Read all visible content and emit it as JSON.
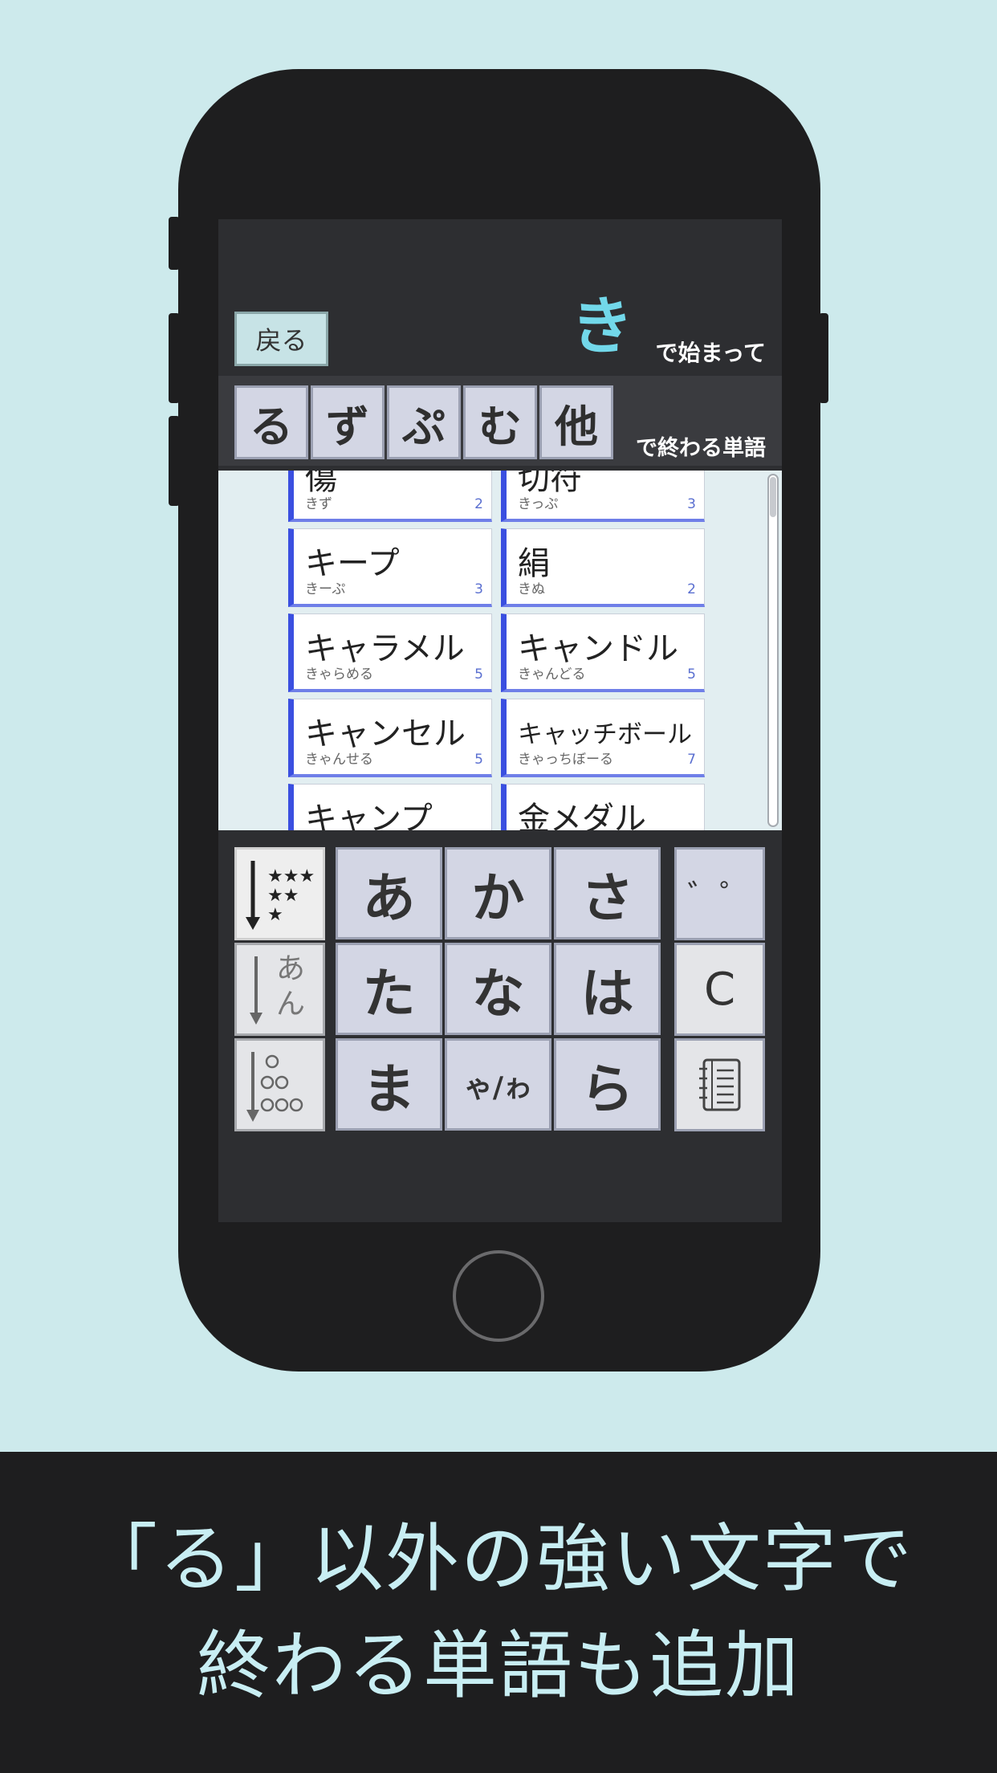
{
  "screen": {
    "back_label": "戻る",
    "start_char": "き",
    "start_suffix": "で始まって",
    "end_tabs": [
      "る",
      "ず",
      "ぷ",
      "む",
      "他"
    ],
    "end_suffix": "で終わる単語"
  },
  "words": [
    {
      "word": "傷",
      "reading": "きず",
      "len": "2"
    },
    {
      "word": "切符",
      "reading": "きっぷ",
      "len": "3"
    },
    {
      "word": "キープ",
      "reading": "きーぷ",
      "len": "3"
    },
    {
      "word": "絹",
      "reading": "きぬ",
      "len": "2"
    },
    {
      "word": "キャラメル",
      "reading": "きゃらめる",
      "len": "5"
    },
    {
      "word": "キャンドル",
      "reading": "きゃんどる",
      "len": "5"
    },
    {
      "word": "キャンセル",
      "reading": "きゃんせる",
      "len": "5"
    },
    {
      "word": "キャッチボール",
      "reading": "きゃっちぼーる",
      "len": "7"
    },
    {
      "word": "キャンプ",
      "reading": "",
      "len": ""
    },
    {
      "word": "金メダル",
      "reading": "",
      "len": ""
    }
  ],
  "keyboard": {
    "keys": [
      "あ",
      "か",
      "さ",
      "た",
      "な",
      "は",
      "ま",
      "ゃ/ゎ",
      "ら"
    ],
    "dakuten_label": "゛゜",
    "clear_label": "C",
    "sort_kana_label": "あん",
    "sort_stars_icon": "star-rating-sort-icon",
    "sort_length_icon": "length-sort-icon",
    "notebook_icon": "notebook-icon"
  },
  "caption": {
    "line1": "「る」以外の強い文字で",
    "line2": "終わる単語も追加"
  },
  "colors": {
    "background": "#cdeaec",
    "phone": "#1e1e1f",
    "key": "#d3d6e4",
    "accent": "#72d8ea",
    "card_border": "#3a4fe0"
  }
}
